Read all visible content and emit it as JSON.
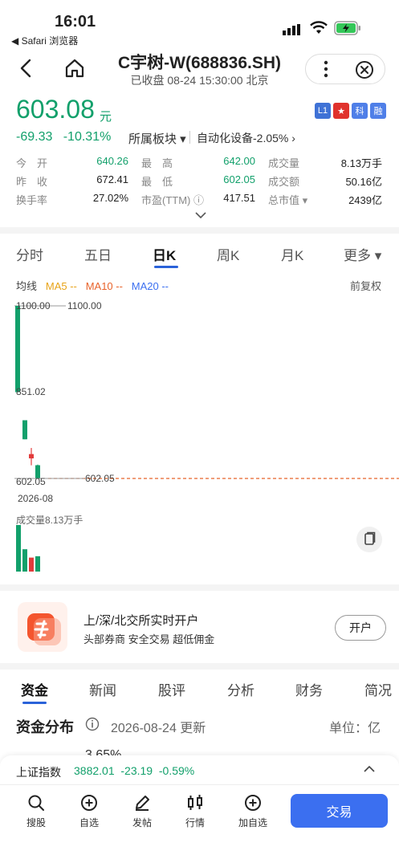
{
  "status_bar": {
    "time": "16:01",
    "back_app": "◀ Safari 浏览器"
  },
  "header": {
    "title": "C宇树-W(688836.SH)",
    "subtitle": "已收盘 08-24 15:30:00 北京"
  },
  "quote": {
    "price": "603.08",
    "price_unit": "元",
    "change": "-69.33",
    "change_pct": "-10.31%",
    "sector_label": "所属板块 ▾",
    "sector_value": "自动化设备-2.05% ›",
    "tags": [
      {
        "text": "L1",
        "color": "#3f72d6"
      },
      {
        "text": "★",
        "color": "#e0322d"
      },
      {
        "text": "科",
        "color": "#4f7fe8"
      },
      {
        "text": "融",
        "color": "#4f7fe8"
      }
    ]
  },
  "stats": [
    {
      "l1": "今　开",
      "v1": "640.26",
      "l2": "最　高",
      "v2": "642.00",
      "l3": "成交量",
      "v3": "8.13万手"
    },
    {
      "l1": "昨　收",
      "v1": "672.41",
      "l2": "最　低",
      "v2": "602.05",
      "l3": "成交额",
      "v3": "50.16亿"
    },
    {
      "l1": "换手率",
      "v1": "27.02%",
      "l2": "市盈(TTM) ⓘ",
      "v2": "417.51",
      "l3": "总市值 ▾",
      "v3": "2439亿"
    }
  ],
  "period_tabs": [
    "分时",
    "五日",
    "日K",
    "周K",
    "月K",
    "更多 ▾"
  ],
  "ma_row": {
    "label": "均线",
    "ma5": "MA5 --",
    "ma10": "MA10 --",
    "ma20": "MA20 --",
    "fuquan": "前复权"
  },
  "colors": {
    "green": "#12a06b",
    "red": "#e23b3b",
    "accent": "#2a62d9",
    "ma5": "#e8a317",
    "ma10": "#e8632b",
    "ma20": "#3b6ff0"
  },
  "chart_data": {
    "type": "candlestick",
    "labels": {
      "high_marker": "1100.00",
      "high_marker_right": "1100.00",
      "mid_label": "851.02",
      "low_marker": "602.05",
      "low_marker_right": "602.05",
      "date_label": "2026-08",
      "volume_label": "成交量8.13万手"
    },
    "ylim": [
      602.05,
      1100.0
    ],
    "candles": [
      {
        "open": 1100.0,
        "close": 851.02,
        "high": 1100.0,
        "low": 851.02
      },
      {
        "open": 770.0,
        "close": 715.0,
        "high": 770.0,
        "low": 715.0
      },
      {
        "open": 660.0,
        "close": 672.41,
        "high": 690.0,
        "low": 640.0
      },
      {
        "open": 640.26,
        "close": 603.08,
        "high": 642.0,
        "low": 602.05
      }
    ],
    "volumes": [
      100,
      48,
      30,
      33
    ],
    "reference_line": 602.05
  },
  "promo": {
    "title": "上/深/北交所实时开户",
    "subtitle": "头部券商 安全交易 超低佣金",
    "button": "开户"
  },
  "bottom_tabs": [
    "资金",
    "新闻",
    "股评",
    "分析",
    "财务",
    "简况"
  ],
  "fund": {
    "title": "资金分布",
    "date": "2026-08-24 更新",
    "unit": "单位：亿",
    "peek": "3.65%"
  },
  "index_bar": {
    "name": "上证指数",
    "value": "3882.01",
    "change": "-23.19",
    "change_pct": "-0.59%"
  },
  "toolbar": {
    "items": [
      "搜股",
      "自选",
      "发帖",
      "行情",
      "加自选"
    ],
    "trade": "交易"
  }
}
